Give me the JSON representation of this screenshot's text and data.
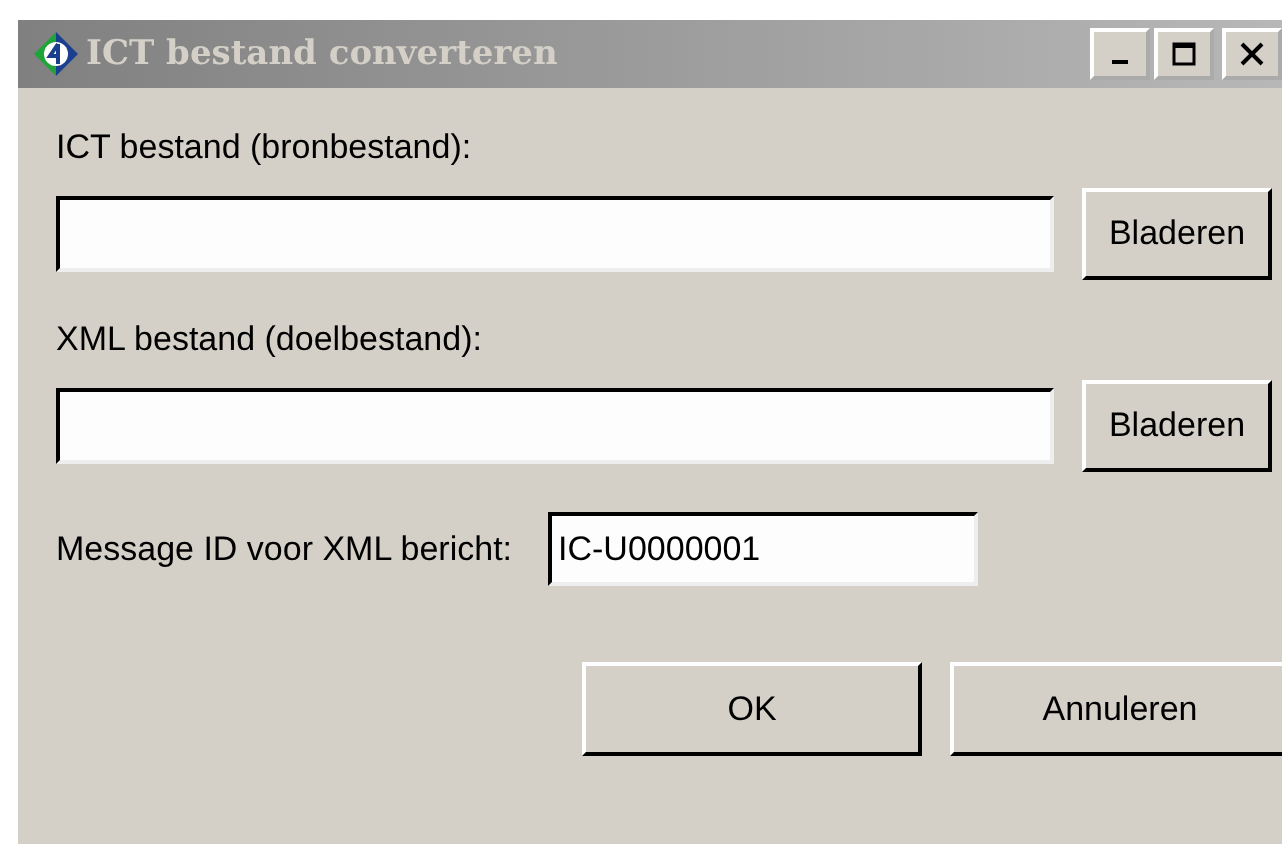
{
  "window": {
    "title": "ICT bestand converteren"
  },
  "fields": [
    {
      "label": "ICT bestand (bronbestand):",
      "button": "Bladeren"
    },
    {
      "label": "XML bestand (doelbestand):",
      "button": "Bladeren"
    }
  ],
  "message_id": {
    "label": "Message ID voor XML bericht:",
    "value": "IC-U0000001"
  },
  "buttons": [
    "OK",
    "Annuleren"
  ]
}
